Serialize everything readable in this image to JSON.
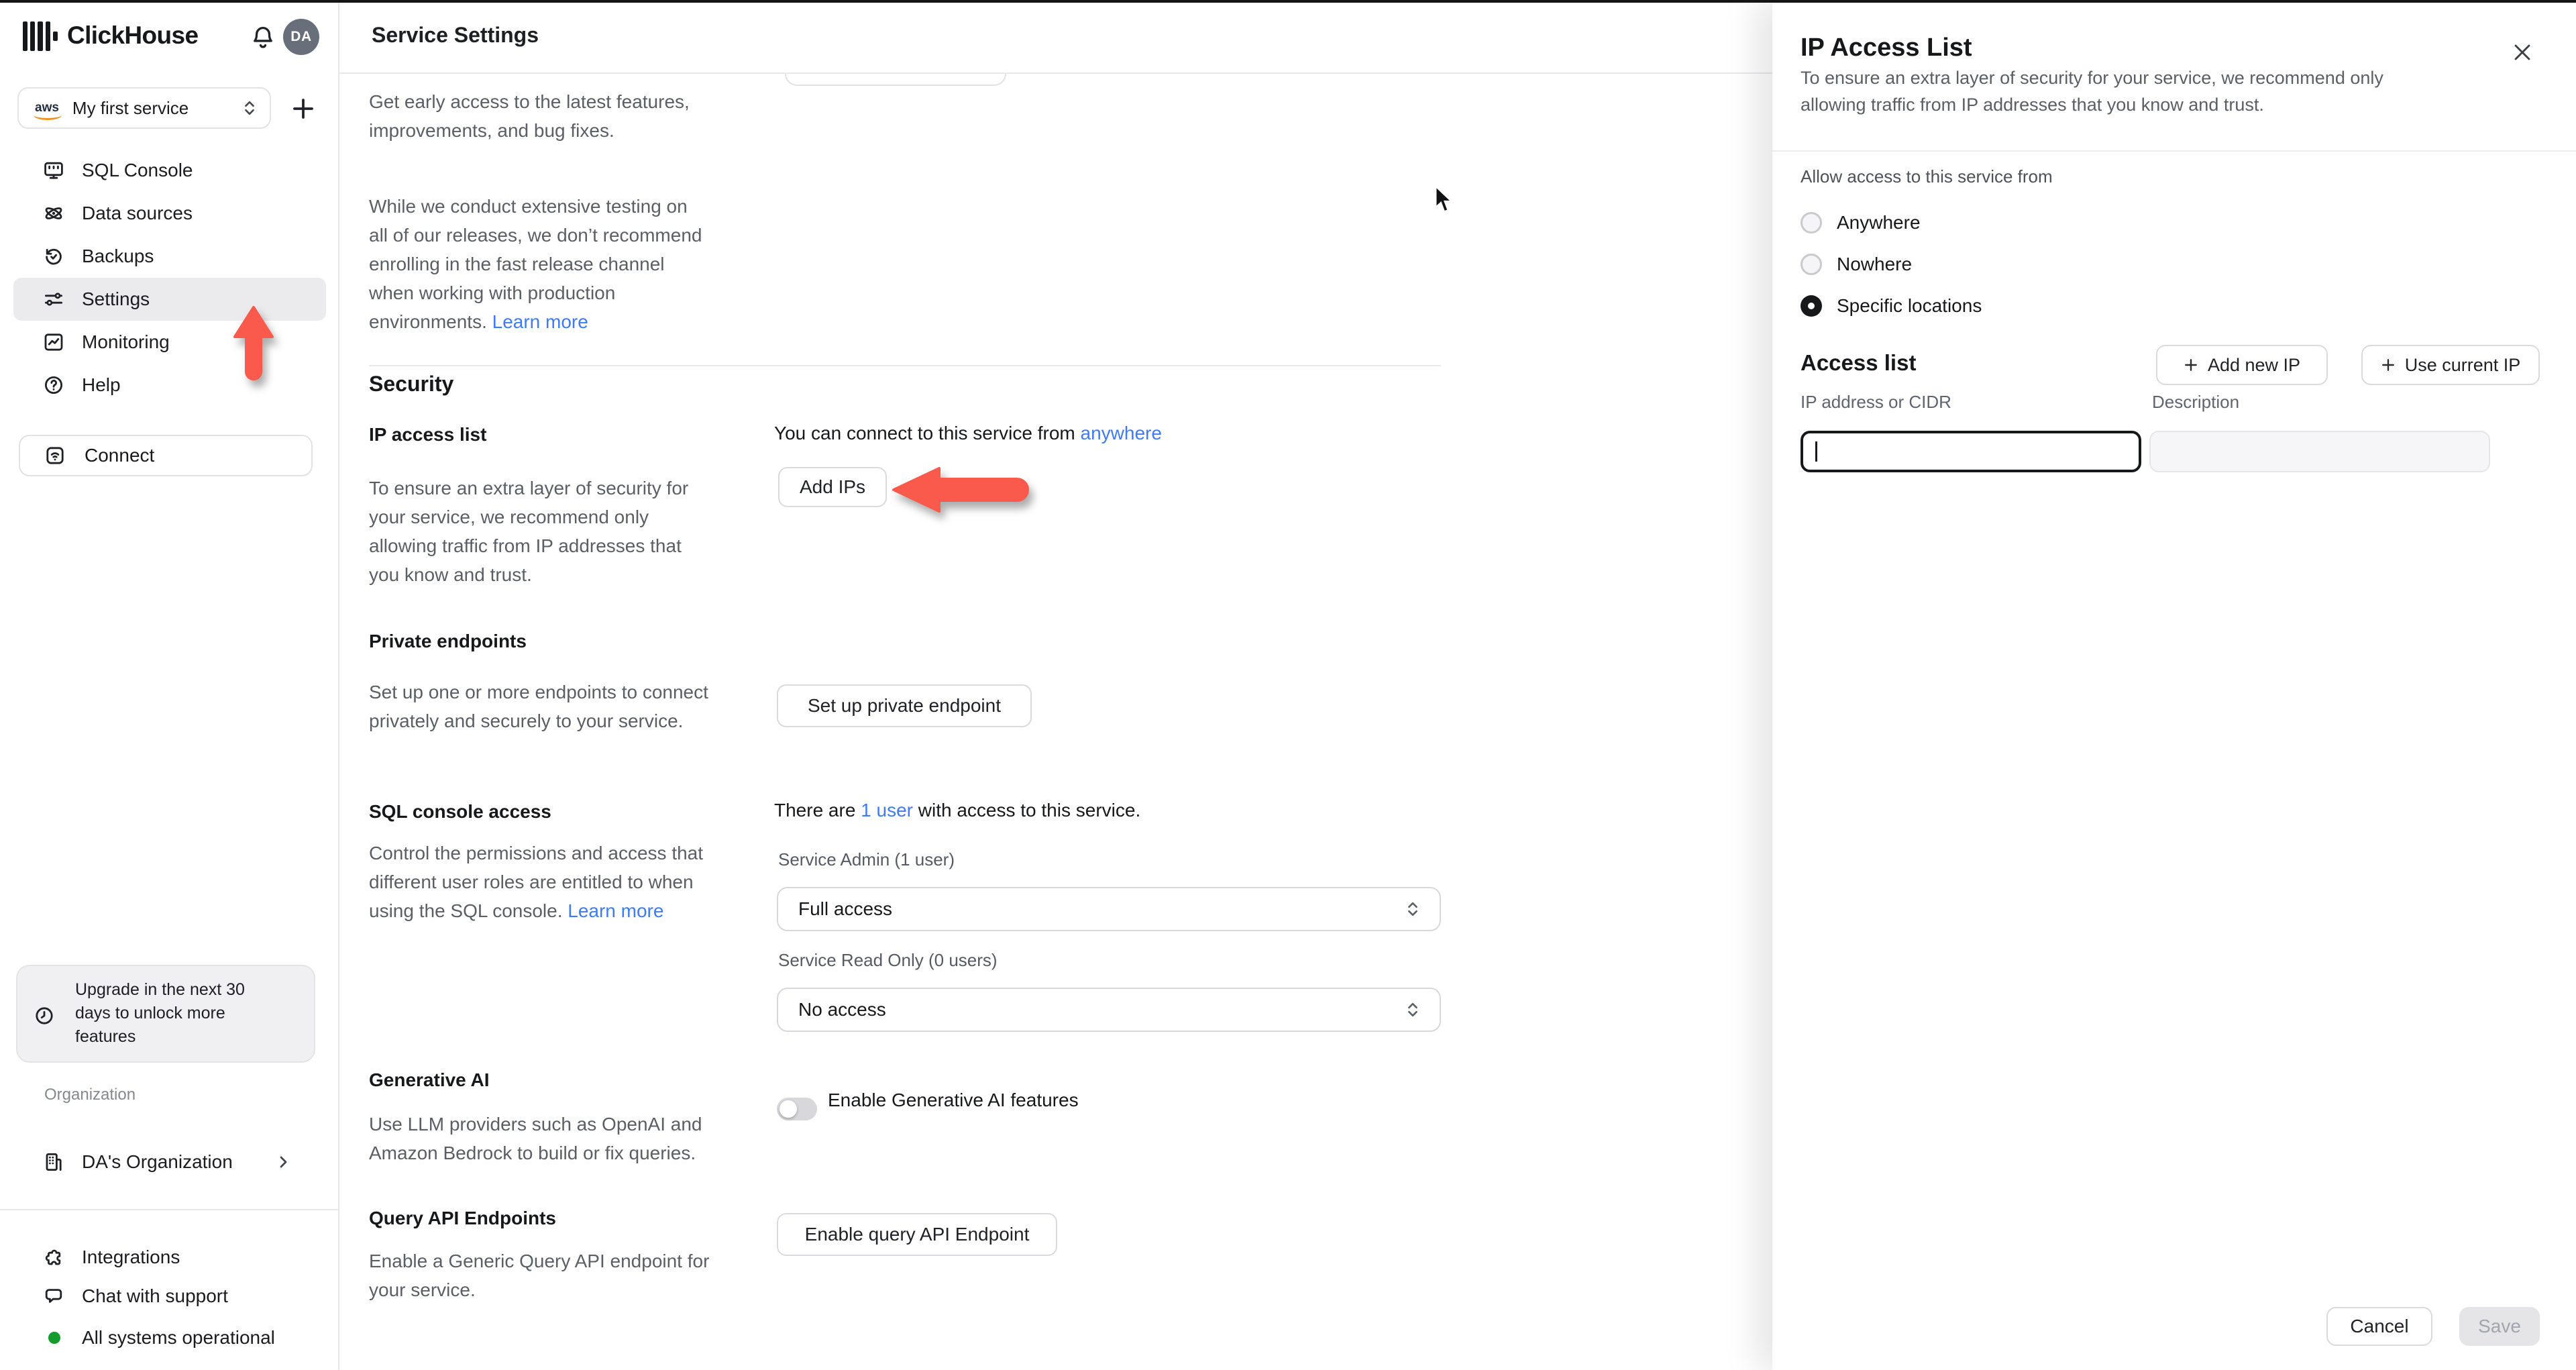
{
  "colors": {
    "accent_arrow": "#fa5a4c",
    "link": "#3e7bf6",
    "status_green": "#149b2e"
  },
  "sidebar": {
    "logo_text": "ClickHouse",
    "avatar_initials": "DA",
    "service_selector": {
      "provider": "aws",
      "label": "My first service"
    },
    "nav": [
      {
        "label": "SQL Console"
      },
      {
        "label": "Data sources"
      },
      {
        "label": "Backups"
      },
      {
        "label": "Settings"
      },
      {
        "label": "Monitoring"
      },
      {
        "label": "Help"
      }
    ],
    "connect_label": "Connect",
    "upgrade_notice": {
      "lines": [
        "Upgrade in the next 30",
        "days to unlock more",
        "features"
      ]
    },
    "organization_label": "Organization",
    "organization_name": "DA's Organization",
    "integrations_label": "Integrations",
    "chat_label": "Chat with support",
    "status_label": "All systems operational"
  },
  "header": {
    "title": "Service Settings"
  },
  "main": {
    "release": {
      "para1": {
        "lines": [
          "Get early access to the latest features,",
          "improvements, and bug fixes."
        ]
      },
      "para2": {
        "lines": [
          "While we conduct extensive testing on",
          "all of our releases, we don’t recommend",
          "enrolling in the fast release channel",
          "when working with production",
          "environments. "
        ],
        "link": "Learn more"
      }
    },
    "security_heading": "Security",
    "ip_access": {
      "label": "IP access list",
      "status_prefix": "You can connect to this service from ",
      "status_link": "anywhere",
      "button": "Add IPs",
      "desc": {
        "lines": [
          "To ensure an extra layer of security for",
          "your service, we recommend only",
          "allowing traffic from IP addresses that",
          "you know and trust."
        ]
      }
    },
    "private_endpoints": {
      "label": "Private endpoints",
      "desc": {
        "lines": [
          "Set up one or more endpoints to connect",
          "privately and securely to your service."
        ]
      },
      "button": "Set up private endpoint"
    },
    "sql_access": {
      "label": "SQL console access",
      "status_prefix": "There are ",
      "status_link": "1 user",
      "status_suffix": " with access to this service.",
      "desc": {
        "lines": [
          "Control the permissions and access that",
          "different user roles are entitled to when",
          "using the SQL console. "
        ],
        "link": "Learn more"
      },
      "admin_label": "Service Admin (1 user)",
      "admin_value": "Full access",
      "readonly_label": "Service Read Only (0 users)",
      "readonly_value": "No access"
    },
    "generative_ai": {
      "label": "Generative AI",
      "toggle_label": "Enable Generative AI features",
      "toggle_on": false,
      "desc": {
        "lines": [
          "Use LLM providers such as OpenAI and",
          "Amazon Bedrock to build or fix queries."
        ]
      }
    },
    "query_api": {
      "label": "Query API Endpoints",
      "button": "Enable query API Endpoint",
      "desc": {
        "lines": [
          "Enable a Generic Query API endpoint for",
          "your service."
        ]
      }
    }
  },
  "panel": {
    "title": "IP Access List",
    "desc": {
      "lines": [
        "To ensure an extra layer of security for your service, we recommend only",
        "allowing traffic from IP addresses that you know and trust."
      ]
    },
    "allow_label": "Allow access to this service from",
    "options": [
      {
        "label": "Anywhere",
        "selected": false
      },
      {
        "label": "Nowhere",
        "selected": false
      },
      {
        "label": "Specific locations",
        "selected": true
      }
    ],
    "access_list_heading": "Access list",
    "add_new_ip": "Add new IP",
    "use_current_ip": "Use current IP",
    "ip_label": "IP address or CIDR",
    "desc_label": "Description",
    "ip_value": "",
    "description_value": "",
    "cancel": "Cancel",
    "save": "Save"
  }
}
